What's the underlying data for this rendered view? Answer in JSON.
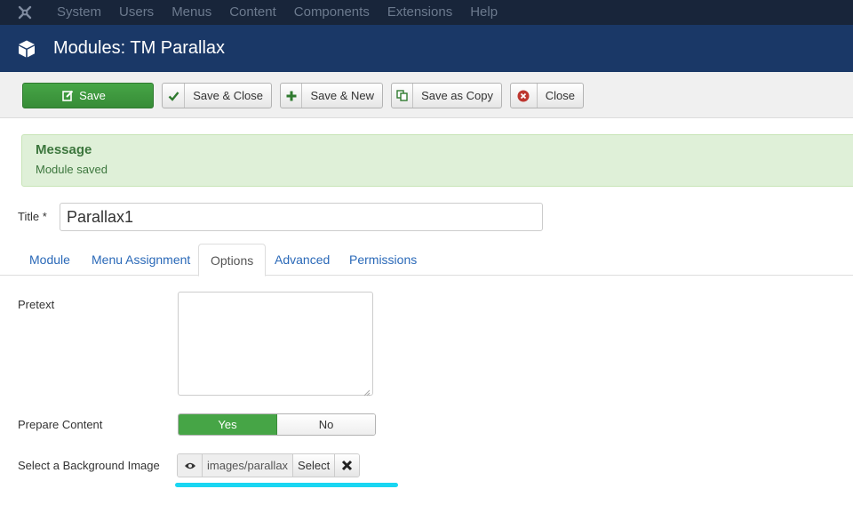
{
  "topnav": {
    "items": [
      "System",
      "Users",
      "Menus",
      "Content",
      "Components",
      "Extensions",
      "Help"
    ]
  },
  "header": {
    "title": "Modules: TM Parallax"
  },
  "toolbar": {
    "save": "Save",
    "save_close": "Save & Close",
    "save_new": "Save & New",
    "save_copy": "Save as Copy",
    "close": "Close"
  },
  "message": {
    "heading": "Message",
    "text": "Module saved"
  },
  "form": {
    "title_label": "Title *",
    "title_value": "Parallax1"
  },
  "tabs": [
    "Module",
    "Menu Assignment",
    "Options",
    "Advanced",
    "Permissions"
  ],
  "active_tab": "Options",
  "options": {
    "pretext_label": "Pretext",
    "pretext_value": "",
    "prepare_label": "Prepare Content",
    "prepare_yes": "Yes",
    "prepare_no": "No",
    "prepare_selected": "Yes",
    "bg_label": "Select a Background Image",
    "bg_path": "images/parallax",
    "bg_select": "Select"
  },
  "colors": {
    "topnav_bg": "#18253a",
    "header_bg": "#1a3867",
    "save_green": "#46a546",
    "message_bg": "#dff0d8",
    "highlight": "#19d6f2",
    "link_blue": "#2a69b8"
  }
}
